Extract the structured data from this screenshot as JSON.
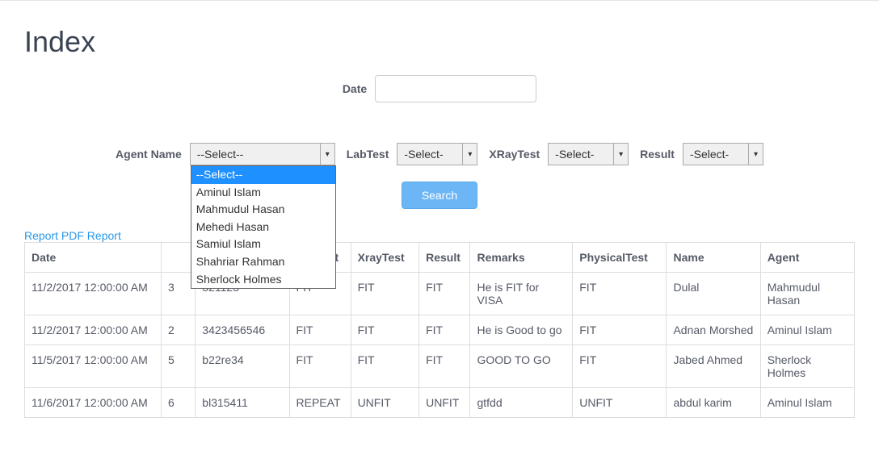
{
  "page": {
    "title": "Index"
  },
  "filters": {
    "date_label": "Date",
    "agent_label": "Agent Name",
    "agent_selected": "--Select--",
    "labtest_label": "LabTest",
    "labtest_selected": "-Select-",
    "xraytest_label": "XRayTest",
    "xraytest_selected": "-Select-",
    "result_label": "Result",
    "result_selected": "-Select-",
    "search_button": "Search"
  },
  "agent_dropdown": {
    "items": [
      "--Select--",
      "Aminul Islam",
      "Mahmudul Hasan",
      "Mehedi Hasan",
      "Samiul Islam",
      "Shahriar Rahman",
      "Sherlock Holmes"
    ]
  },
  "links": {
    "report": "Report",
    "pdf_report": "PDF Report"
  },
  "table": {
    "headers": {
      "date": "Date",
      "labtest": "LabTest",
      "xraytest": "XrayTest",
      "result": "Result",
      "remarks": "Remarks",
      "physicaltest": "PhysicalTest",
      "name": "Name",
      "agent": "Agent"
    },
    "rows": [
      {
        "date": "11/2/2017 12:00:00 AM",
        "col2": "3",
        "col3": "321123",
        "labtest": "FIT",
        "xraytest": "FIT",
        "result": "FIT",
        "remarks": "He is FIT for VISA",
        "physical": "FIT",
        "name": "Dulal",
        "agent": "Mahmudul Hasan"
      },
      {
        "date": "11/2/2017 12:00:00 AM",
        "col2": "2",
        "col3": "3423456546",
        "labtest": "FIT",
        "xraytest": "FIT",
        "result": "FIT",
        "remarks": "He is Good to go",
        "physical": "FIT",
        "name": "Adnan Morshed",
        "agent": "Aminul Islam"
      },
      {
        "date": "11/5/2017 12:00:00 AM",
        "col2": "5",
        "col3": "b22re34",
        "labtest": "FIT",
        "xraytest": "FIT",
        "result": "FIT",
        "remarks": "GOOD TO GO",
        "physical": "FIT",
        "name": "Jabed Ahmed",
        "agent": "Sherlock Holmes"
      },
      {
        "date": "11/6/2017 12:00:00 AM",
        "col2": "6",
        "col3": "bl315411",
        "labtest": "REPEAT",
        "xraytest": "UNFIT",
        "result": "UNFIT",
        "remarks": "gtfdd",
        "physical": "UNFIT",
        "name": "abdul karim",
        "agent": "Aminul Islam"
      }
    ]
  }
}
